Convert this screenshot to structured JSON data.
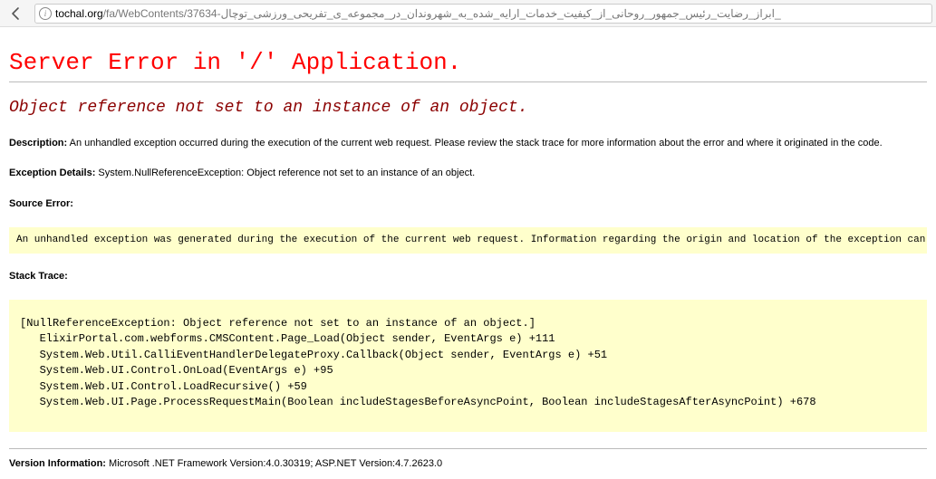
{
  "browser": {
    "url_domain": "tochal.org",
    "url_path": "/fa/WebContents/37634-ابراز_رضایت_رئیس_جمهور_روحانی_از_کیفیت_خدمات_ارایه_شده_به_شهروندان_در_مجموعه_ی_تفریحی_ورزشی_توچال_"
  },
  "page": {
    "heading": "Server Error in '/' Application.",
    "subheading": "Object reference not set to an instance of an object.",
    "description_label": "Description:",
    "description_text": " An unhandled exception occurred during the execution of the current web request. Please review the stack trace for more information about the error and where it originated in the code.",
    "exception_label": "Exception Details:",
    "exception_text": " System.NullReferenceException: Object reference not set to an instance of an object.",
    "source_error_label": "Source Error:",
    "source_error_box": "An unhandled exception was generated during the execution of the current web request. Information regarding the origin and location of the exception can be identified using the exception stack trace below",
    "stack_trace_label": "Stack Trace:",
    "stack_trace_box": "[NullReferenceException: Object reference not set to an instance of an object.]\n   ElixirPortal.com.webforms.CMSContent.Page_Load(Object sender, EventArgs e) +111\n   System.Web.Util.CalliEventHandlerDelegateProxy.Callback(Object sender, EventArgs e) +51\n   System.Web.UI.Control.OnLoad(EventArgs e) +95\n   System.Web.UI.Control.LoadRecursive() +59\n   System.Web.UI.Page.ProcessRequestMain(Boolean includeStagesBeforeAsyncPoint, Boolean includeStagesAfterAsyncPoint) +678",
    "version_label": "Version Information:",
    "version_text": " Microsoft .NET Framework Version:4.0.30319; ASP.NET Version:4.7.2623.0"
  }
}
